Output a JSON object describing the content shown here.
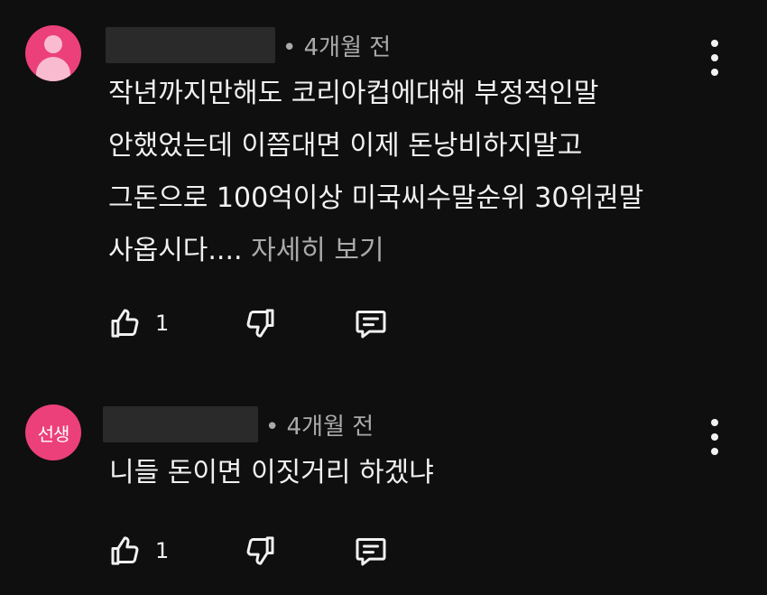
{
  "comments": [
    {
      "avatar_type": "default-person",
      "avatar_color": "#ec407a",
      "time": "• 4개월 전",
      "text_lines": [
        "작년까지만해도 코리아컵에대해 부정적인말",
        "안했었는데 이쯤대면 이제 돈낭비하지말고",
        "그돈으로 100억이상 미국씨수말순위 30위권말",
        "사옵시다...."
      ],
      "read_more": "자세히 보기",
      "likes": "1"
    },
    {
      "avatar_text": "선생",
      "avatar_color": "#ec407a",
      "time": "• 4개월 전",
      "text_lines": [
        "니들 돈이면 이짓거리 하겠냐"
      ],
      "likes": "1"
    }
  ],
  "icons": {
    "like": "thumbs-up-icon",
    "dislike": "thumbs-down-icon",
    "reply": "reply-comment-icon",
    "more": "more-vert-icon"
  }
}
